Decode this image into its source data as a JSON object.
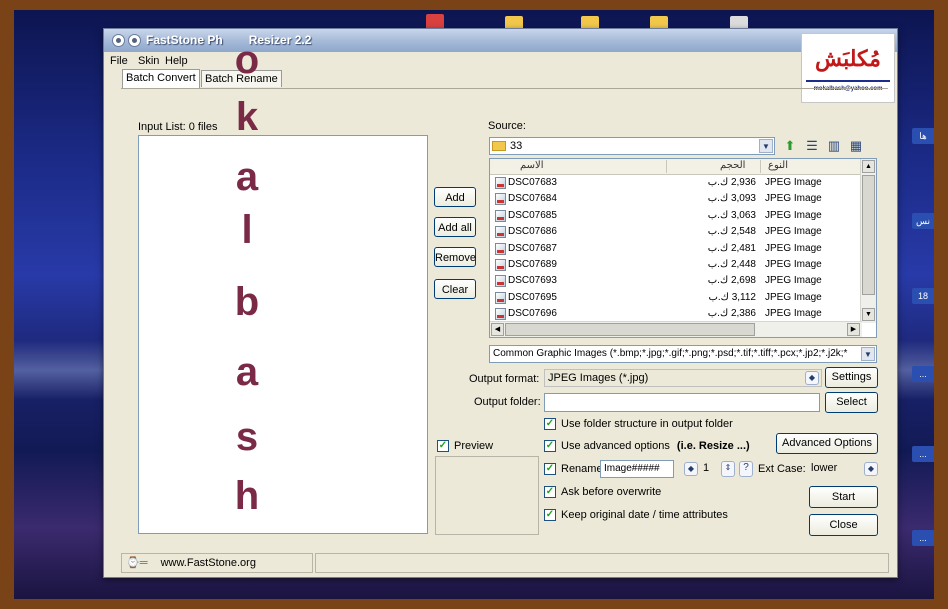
{
  "window": {
    "title": "FastStone Photo Resizer 2.2",
    "title_visible": "FastStone Ph",
    "title_visible_end": "Resizer 2.2"
  },
  "logo": {
    "text": "مُكلبَش",
    "email": "mokalbash@yahoo.com"
  },
  "menu": {
    "file": "File",
    "skin": "Skin",
    "help": "Help"
  },
  "tabs": {
    "batch_convert": "Batch Convert",
    "batch_rename": "Batch Rename"
  },
  "input_list": {
    "label": "Input List:  0 files"
  },
  "watermark": {
    "letters": [
      "o",
      "k",
      "a",
      "l",
      "b",
      "a",
      "s",
      "h"
    ]
  },
  "side_buttons": {
    "add": "Add",
    "add_all": "Add all",
    "remove": "Remove",
    "clear": "Clear"
  },
  "source": {
    "label": "Source:",
    "folder": "33"
  },
  "file_list": {
    "headers": {
      "name": "الاسم",
      "size": "الحجم",
      "type": "النوع"
    },
    "rows": [
      {
        "name": "DSC07683",
        "size": "2,936 ك.ب",
        "type": "JPEG Image"
      },
      {
        "name": "DSC07684",
        "size": "3,093 ك.ب",
        "type": "JPEG Image"
      },
      {
        "name": "DSC07685",
        "size": "3,063 ك.ب",
        "type": "JPEG Image"
      },
      {
        "name": "DSC07686",
        "size": "2,548 ك.ب",
        "type": "JPEG Image"
      },
      {
        "name": "DSC07687",
        "size": "2,481 ك.ب",
        "type": "JPEG Image"
      },
      {
        "name": "DSC07689",
        "size": "2,448 ك.ب",
        "type": "JPEG Image"
      },
      {
        "name": "DSC07693",
        "size": "2,698 ك.ب",
        "type": "JPEG Image"
      },
      {
        "name": "DSC07695",
        "size": "3,112 ك.ب",
        "type": "JPEG Image"
      },
      {
        "name": "DSC07696",
        "size": "2,386 ك.ب",
        "type": "JPEG Image"
      }
    ]
  },
  "filter": {
    "value": "Common Graphic Images (*.bmp;*.jpg;*.gif;*.png;*.psd;*.tif;*.tiff;*.pcx;*.jp2;*.j2k;*"
  },
  "output": {
    "format_label": "Output format:",
    "format_value": "JPEG Images (*.jpg)",
    "settings": "Settings",
    "folder_label": "Output folder:",
    "folder_value": "",
    "select": "Select"
  },
  "options": {
    "use_folder_structure": "Use folder structure in output folder",
    "use_advanced": "Use advanced options",
    "use_advanced_hint": "(i.e. Resize ...)",
    "advanced_button": "Advanced Options",
    "rename": "Rename",
    "rename_pattern": "Image#####",
    "rename_start": "1",
    "help_q": "?",
    "ext_case_label": "Ext Case:",
    "ext_case_value": "lower",
    "ask_overwrite": "Ask before overwrite",
    "keep_date": "Keep original date / time attributes",
    "preview": "Preview"
  },
  "actions": {
    "start": "Start",
    "close": "Close"
  },
  "status": {
    "url": "www.FastStone.org"
  },
  "desktop": {
    "right_labels": [
      "ها",
      "نس",
      "18",
      "..."
    ]
  }
}
